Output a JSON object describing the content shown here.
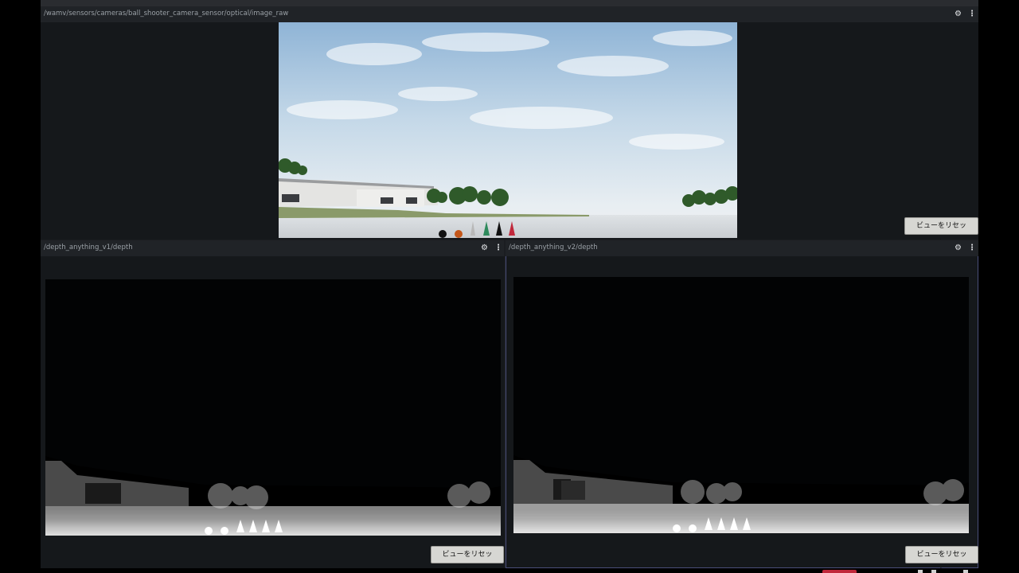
{
  "panels": {
    "camera": {
      "title": "/wamv/sensors/cameras/ball_shooter_camera_sensor/optical/image_raw",
      "reset_label": "ビューをリセット"
    },
    "depth_v1": {
      "title": "/depth_anything_v1/depth",
      "reset_label": "ビューをリセット"
    },
    "depth_v2": {
      "title": "/depth_anything_v2/depth",
      "reset_label": "ビューをリセット"
    }
  },
  "icons": {
    "settings": "gear-icon",
    "menu": "more-vert-icon"
  },
  "colors": {
    "panel_bg": "#15181b",
    "header_bg": "#202327",
    "active_border": "#4a4f7a",
    "button_bg": "#d7d7d3"
  }
}
